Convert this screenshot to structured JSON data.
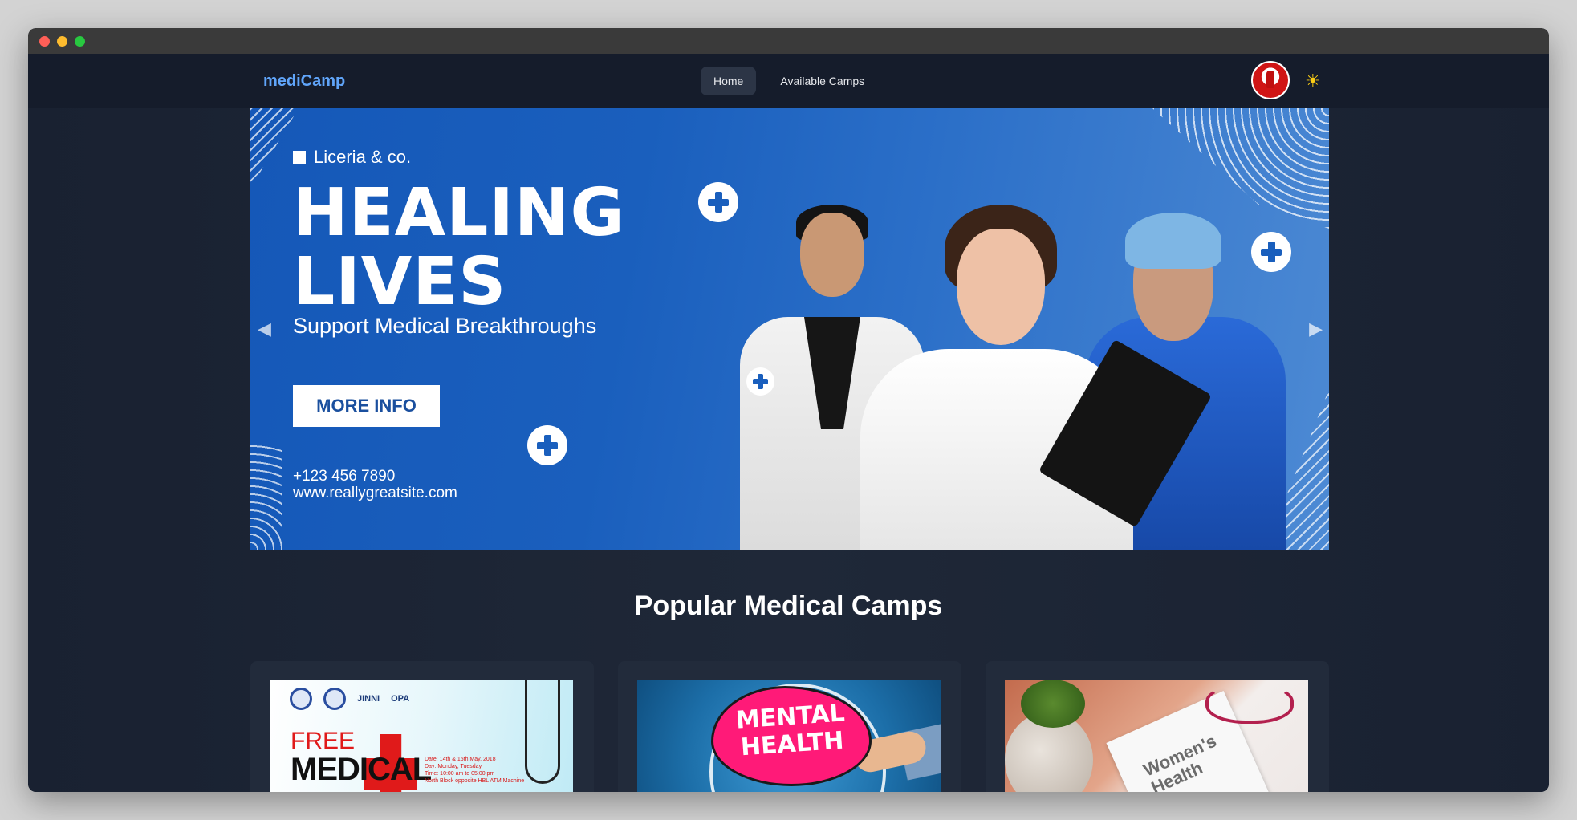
{
  "nav": {
    "brand": "mediCamp",
    "links": [
      "Home",
      "Available Camps"
    ],
    "active": "Home",
    "theme_icon": "sun-icon"
  },
  "banner": {
    "brand_line": "Liceria & co.",
    "headline_1": "HEALING",
    "headline_2": "LIVES",
    "subline": "Support Medical Breakthroughs",
    "button": "MORE INFO",
    "phone": "+123 456 7890",
    "website": "www.reallygreatsite.com",
    "prev_icon": "◀",
    "next_icon": "▶"
  },
  "section": {
    "title": "Popular Medical Camps"
  },
  "cards": [
    {
      "free": "FREE",
      "medical": "MEDICAL",
      "logo": "JINNI",
      "logo2": "OPA",
      "details": [
        "Date: 14th & 15th May, 2018",
        "Day: Monday, Tuesday",
        "Time: 10:00 am to 05:00 pm",
        "North Block opposite HBL ATM Machine"
      ]
    },
    {
      "line1": "MENTAL",
      "line2": "HEALTH"
    },
    {
      "line1": "Women's",
      "line2": "Health"
    }
  ],
  "colors": {
    "brand": "#60a5fa",
    "page_bg": "#1d2533",
    "navbar_bg": "#151c2b",
    "banner_blue": "#1a5fbd",
    "sun": "#facc15"
  }
}
